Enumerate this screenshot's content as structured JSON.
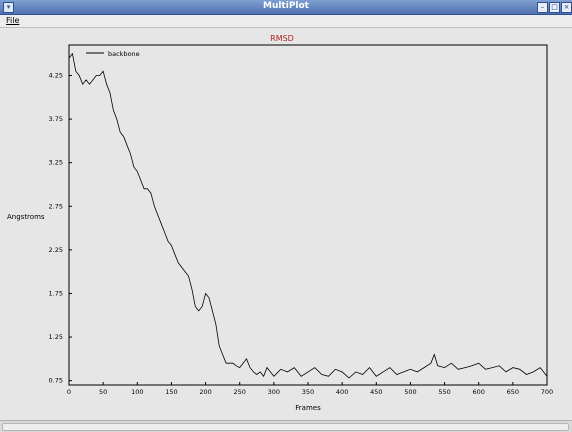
{
  "window": {
    "title": "MultiPlot"
  },
  "menu": {
    "file_label": "File"
  },
  "colors": {
    "title_text": "#b22222",
    "series": "#000000",
    "plot_background": "#e6e6e6"
  },
  "chart_data": {
    "type": "line",
    "title": "RMSD",
    "xlabel": "Frames",
    "ylabel": "Angstroms",
    "xlim": [
      0,
      700
    ],
    "ylim": [
      0.7,
      4.6
    ],
    "x_ticks": [
      0,
      50,
      100,
      150,
      200,
      250,
      300,
      350,
      400,
      450,
      500,
      550,
      600,
      650,
      700
    ],
    "y_ticks": [
      0.75,
      1.25,
      1.75,
      2.25,
      2.75,
      3.25,
      3.75,
      4.25
    ],
    "y_tick_labels": [
      "0.75",
      "1.25",
      "1.75",
      "2.25",
      "2.75",
      "3.25",
      "3.75",
      "4.25"
    ],
    "legend_placement": "top-left",
    "grid": false,
    "series": [
      {
        "name": "backbone",
        "x": [
          0,
          5,
          10,
          15,
          20,
          25,
          30,
          35,
          40,
          45,
          50,
          55,
          60,
          65,
          70,
          75,
          80,
          85,
          90,
          95,
          100,
          105,
          110,
          115,
          120,
          125,
          130,
          135,
          140,
          145,
          150,
          155,
          160,
          165,
          170,
          175,
          180,
          185,
          190,
          195,
          200,
          205,
          210,
          215,
          220,
          225,
          230,
          235,
          240,
          245,
          250,
          255,
          260,
          265,
          270,
          275,
          280,
          285,
          290,
          295,
          300,
          310,
          320,
          330,
          340,
          350,
          360,
          370,
          380,
          390,
          400,
          410,
          420,
          430,
          440,
          450,
          460,
          470,
          480,
          490,
          500,
          510,
          520,
          530,
          535,
          540,
          550,
          560,
          570,
          580,
          590,
          600,
          610,
          620,
          630,
          640,
          650,
          660,
          670,
          680,
          690,
          700
        ],
        "y": [
          4.45,
          4.5,
          4.3,
          4.25,
          4.15,
          4.2,
          4.15,
          4.2,
          4.25,
          4.25,
          4.3,
          4.15,
          4.05,
          3.85,
          3.75,
          3.6,
          3.55,
          3.45,
          3.35,
          3.2,
          3.15,
          3.05,
          2.95,
          2.95,
          2.9,
          2.75,
          2.65,
          2.55,
          2.45,
          2.35,
          2.3,
          2.2,
          2.1,
          2.05,
          2.0,
          1.95,
          1.8,
          1.6,
          1.55,
          1.6,
          1.75,
          1.7,
          1.55,
          1.4,
          1.15,
          1.05,
          0.95,
          0.95,
          0.95,
          0.92,
          0.9,
          0.95,
          1.0,
          0.9,
          0.85,
          0.82,
          0.85,
          0.8,
          0.9,
          0.85,
          0.8,
          0.88,
          0.85,
          0.9,
          0.8,
          0.85,
          0.9,
          0.82,
          0.8,
          0.88,
          0.85,
          0.78,
          0.85,
          0.82,
          0.9,
          0.8,
          0.85,
          0.9,
          0.82,
          0.85,
          0.88,
          0.85,
          0.9,
          0.95,
          1.05,
          0.92,
          0.9,
          0.95,
          0.88,
          0.9,
          0.92,
          0.95,
          0.88,
          0.9,
          0.92,
          0.85,
          0.9,
          0.88,
          0.82,
          0.85,
          0.9,
          0.8
        ]
      }
    ]
  }
}
